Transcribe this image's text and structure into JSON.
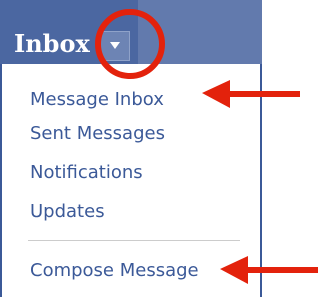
{
  "menu": {
    "title": "Inbox",
    "dropdown_icon": "triangle-down-icon",
    "items": [
      {
        "label": "Message Inbox"
      },
      {
        "label": "Sent Messages"
      },
      {
        "label": "Notifications"
      },
      {
        "label": "Updates"
      },
      {
        "label": "Compose Message"
      }
    ]
  },
  "colors": {
    "header_bg": "#3b5998",
    "tab_bg": "#4b67a1",
    "link": "#3b5998",
    "annotation": "#e3220c"
  }
}
